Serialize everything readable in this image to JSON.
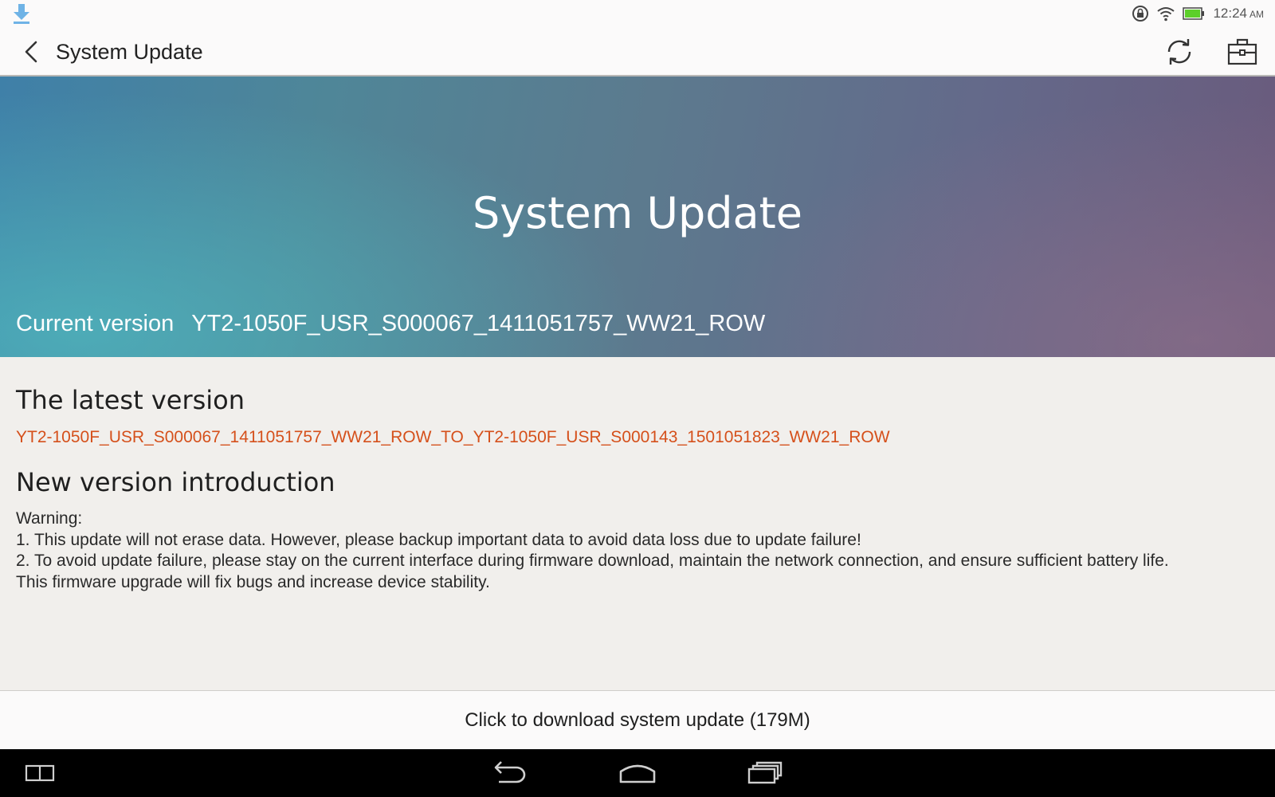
{
  "status_bar": {
    "time": "12:24",
    "ampm": "AM",
    "icons": [
      "download-icon",
      "lock-rotation-icon",
      "wifi-icon",
      "battery-icon"
    ],
    "battery_color": "#5ccf2a"
  },
  "action_bar": {
    "title": "System Update",
    "icons": [
      "back-arrow-icon",
      "refresh-icon",
      "toolbox-icon"
    ]
  },
  "hero": {
    "title": "System Update",
    "current_version_label": "Current version",
    "current_version_value": "YT2-1050F_USR_S000067_1411051757_WW21_ROW"
  },
  "latest": {
    "heading": "The latest version",
    "value": "YT2-1050F_USR_S000067_1411051757_WW21_ROW_TO_YT2-1050F_USR_S000143_1501051823_WW21_ROW"
  },
  "introduction": {
    "heading": "New version introduction",
    "lines": [
      "Warning:",
      "1. This update will not erase data. However, please backup important data to avoid data loss due to update failure!",
      "2. To avoid update failure, please stay on the current interface during firmware download, maintain the network connection, and ensure sufficient battery life.",
      "This firmware upgrade will fix bugs and increase device stability."
    ]
  },
  "download": {
    "label": "Click to download system update (179M)"
  },
  "nav_bar": {
    "icons": [
      "split-screen-icon",
      "back-nav-icon",
      "home-icon",
      "recent-apps-icon"
    ]
  },
  "colors": {
    "accent_orange": "#d5501b",
    "status_download_blue": "#6fb3e6"
  }
}
